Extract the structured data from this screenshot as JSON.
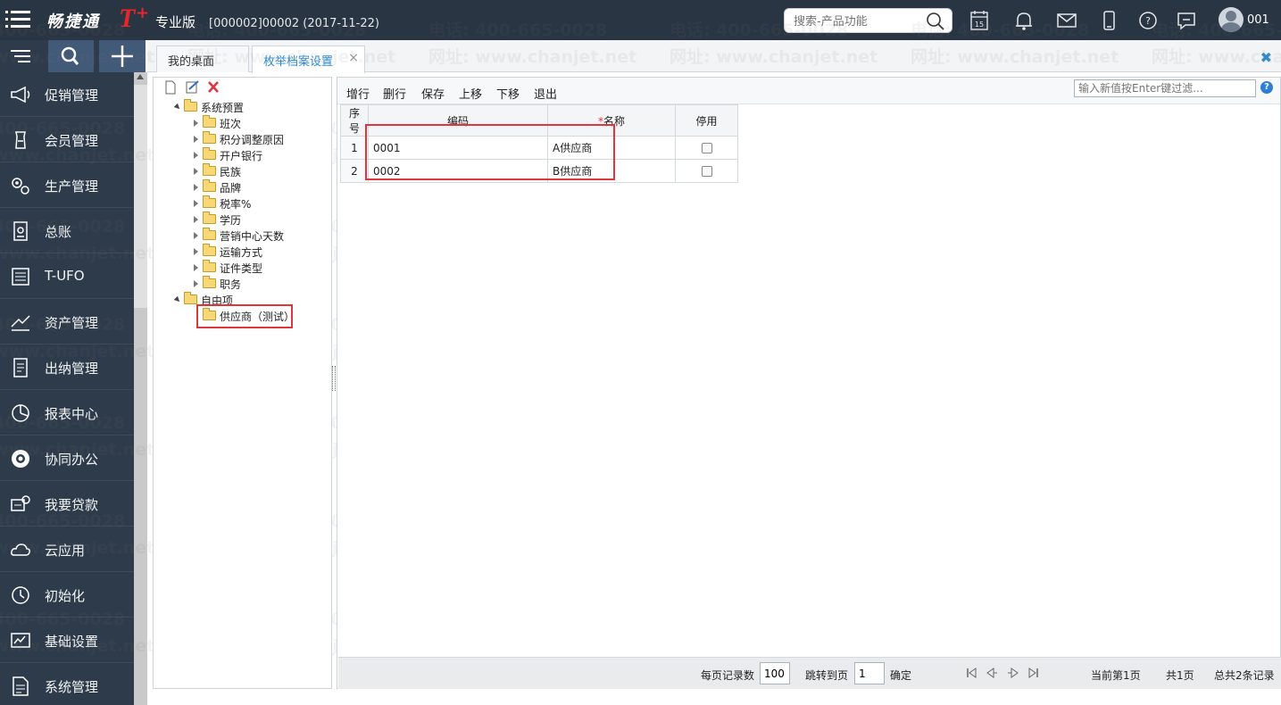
{
  "app": {
    "brand": "畅捷通",
    "brand_t": "T",
    "brand_plus": "+",
    "edition": "专业版",
    "account": "[000002]00002   (2017-11-22)"
  },
  "search": {
    "placeholder": "搜索-产品功能"
  },
  "calendar": {
    "day": "15"
  },
  "user": {
    "name": "001"
  },
  "nav": {
    "items": [
      {
        "label": "促销管理",
        "icon": "megaphone-icon"
      },
      {
        "label": "会员管理",
        "icon": "member-icon"
      },
      {
        "label": "生产管理",
        "icon": "gears-icon"
      },
      {
        "label": "总账",
        "icon": "ledger-icon"
      },
      {
        "label": "T-UFO",
        "icon": "ufo-report-icon"
      },
      {
        "label": "资产管理",
        "icon": "asset-icon"
      },
      {
        "label": "出纳管理",
        "icon": "cashier-icon"
      },
      {
        "label": "报表中心",
        "icon": "pie-chart-icon"
      },
      {
        "label": "协同办公",
        "icon": "collaboration-icon"
      },
      {
        "label": "我要贷款",
        "icon": "loan-icon"
      },
      {
        "label": "云应用",
        "icon": "cloud-icon"
      },
      {
        "label": "初始化",
        "icon": "init-clock-icon"
      },
      {
        "label": "基础设置",
        "icon": "basic-settings-icon"
      },
      {
        "label": "系统管理",
        "icon": "system-manage-icon"
      }
    ]
  },
  "tabs": [
    {
      "label": "我的桌面"
    },
    {
      "label": "枚举档案设置",
      "close": "×"
    }
  ],
  "close_all": "✖",
  "tree": {
    "root1": "系统预置",
    "children1": [
      "班次",
      "积分调整原因",
      "开户银行",
      "民族",
      "品牌",
      "税率%",
      "学历",
      "营销中心天数",
      "运输方式",
      "证件类型",
      "职务"
    ],
    "root2": "自由项",
    "children2": [
      "供应商（测试）"
    ]
  },
  "toolbar": {
    "buttons": [
      "增行",
      "删行",
      "保存",
      "上移",
      "下移",
      "退出"
    ],
    "filter_placeholder": "输入新值按Enter键过滤...",
    "help": "?"
  },
  "grid": {
    "headers": {
      "seq": "序号",
      "code": "编码",
      "req_mark": "*",
      "name": "名称",
      "disabled": "停用"
    },
    "rows": [
      {
        "seq": "1",
        "code": "0001",
        "name": "A供应商",
        "disabled": false
      },
      {
        "seq": "2",
        "code": "0002",
        "name": "B供应商",
        "disabled": false
      }
    ]
  },
  "pager": {
    "per_page_label": "每页记录数",
    "per_page": "100",
    "goto_label": "跳转到页",
    "goto_page": "1",
    "confirm": "确定",
    "current": "当前第1页",
    "total_pages": "共1页",
    "total_records": "总共2条记录"
  },
  "watermark": {
    "phone": "电话: 400-665-0028",
    "site": "网址: www.chanjet.net"
  }
}
